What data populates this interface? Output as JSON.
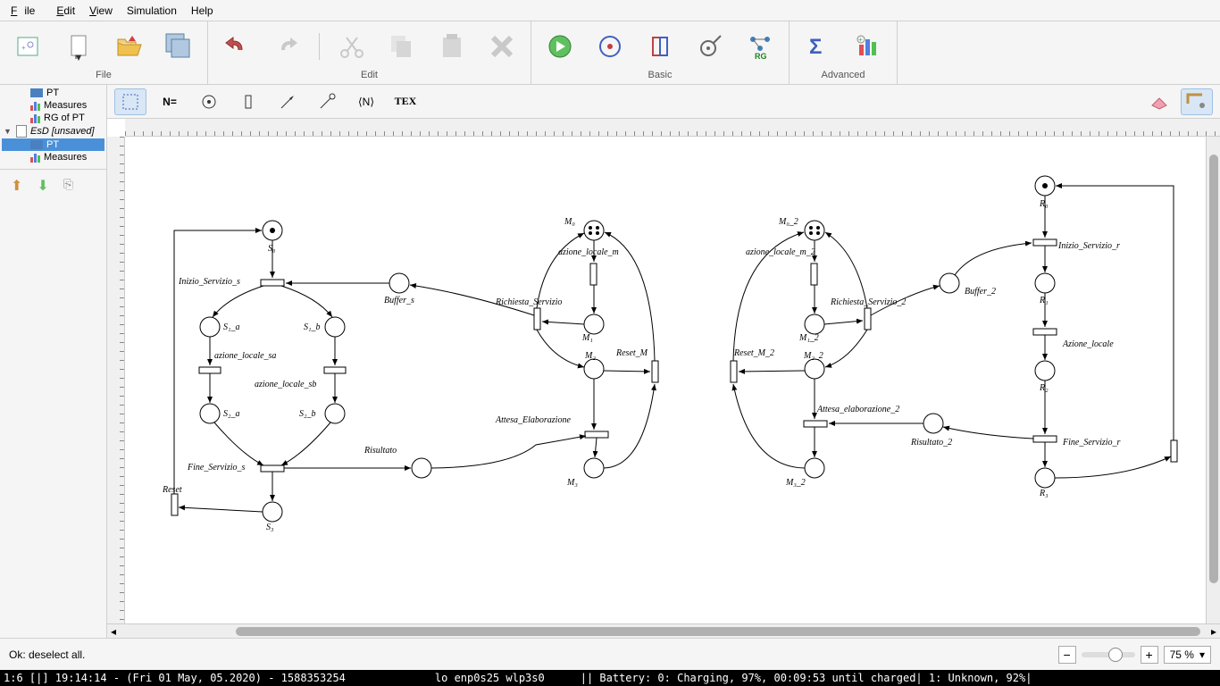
{
  "menu": {
    "file": "File",
    "edit": "Edit",
    "view": "View",
    "simulation": "Simulation",
    "help": "Help"
  },
  "toolbar_groups": {
    "file": "File",
    "edit": "Edit",
    "basic": "Basic",
    "advanced": "Advanced"
  },
  "sidebar": {
    "items": [
      {
        "label": "PT"
      },
      {
        "label": "Measures"
      },
      {
        "label": "RG of PT"
      },
      {
        "label": "EsD [unsaved]"
      },
      {
        "label": "PT"
      },
      {
        "label": "Measures"
      }
    ]
  },
  "tool_strip": {
    "name_tool": "N=",
    "angle_tool": "⟨N⟩",
    "tex_tool": "TEX"
  },
  "status": {
    "message": "Ok: deselect all.",
    "zoom": "75 %"
  },
  "taskbar": {
    "left": "1:6 [|]   19:14:14 - (Fri 01 May, 05.2020) - 1588353254",
    "mid": "lo enp0s25 wlp3s0",
    "right": "||  Battery: 0: Charging, 97%, 00:09:53 until charged| 1: Unknown, 92%|"
  },
  "petri_net": {
    "labels": {
      "S0": "S₀",
      "Inizio_Servizio_s": "Inizio_Servizio_s",
      "S1a": "S₁_a",
      "S1b": "S₁_b",
      "azione_locale_sa": "azione_locale_sa",
      "azione_locale_sb": "azione_locale_sb",
      "S2a": "S₂_a",
      "S2b": "S₂_b",
      "Fine_Servizio_s": "Fine_Servizio_s",
      "Reset": "Reset",
      "S3": "S₃",
      "Risultato": "Risultato",
      "Buffer_s": "Buffer_s",
      "M0": "M₀",
      "azione_locale_m": "azione_locale_m",
      "Richiesta_Servizio": "Richiesta_Servizio",
      "M1": "M₁",
      "M2": "M₂",
      "Reset_M": "Reset_M",
      "Attesa_Elaborazione": "Attesa_Elaborazione",
      "M3": "M₃",
      "M0_2": "M₀_2",
      "azione_locale_m_2": "azione_locale_m_2",
      "Richiesta_Servizio_2": "Richiesta_Servizio_2",
      "M1_2": "M₁_2",
      "M2_2": "M₂_2",
      "Reset_M_2": "Reset_M_2",
      "Attesa_elaborazione_2": "Attesa_elaborazione_2",
      "M3_2": "M₃_2",
      "Risultato_2": "Risultato_2",
      "Buffer_2": "Buffer_2",
      "R0": "R₀",
      "Inizio_Servizio_r": "Inizio_Servizio_r",
      "R1": "R₁",
      "Azione_locale": "Azione_locale",
      "R2": "R₂",
      "Fine_Servizio_r": "Fine_Servizio_r",
      "R3": "R₃"
    }
  }
}
